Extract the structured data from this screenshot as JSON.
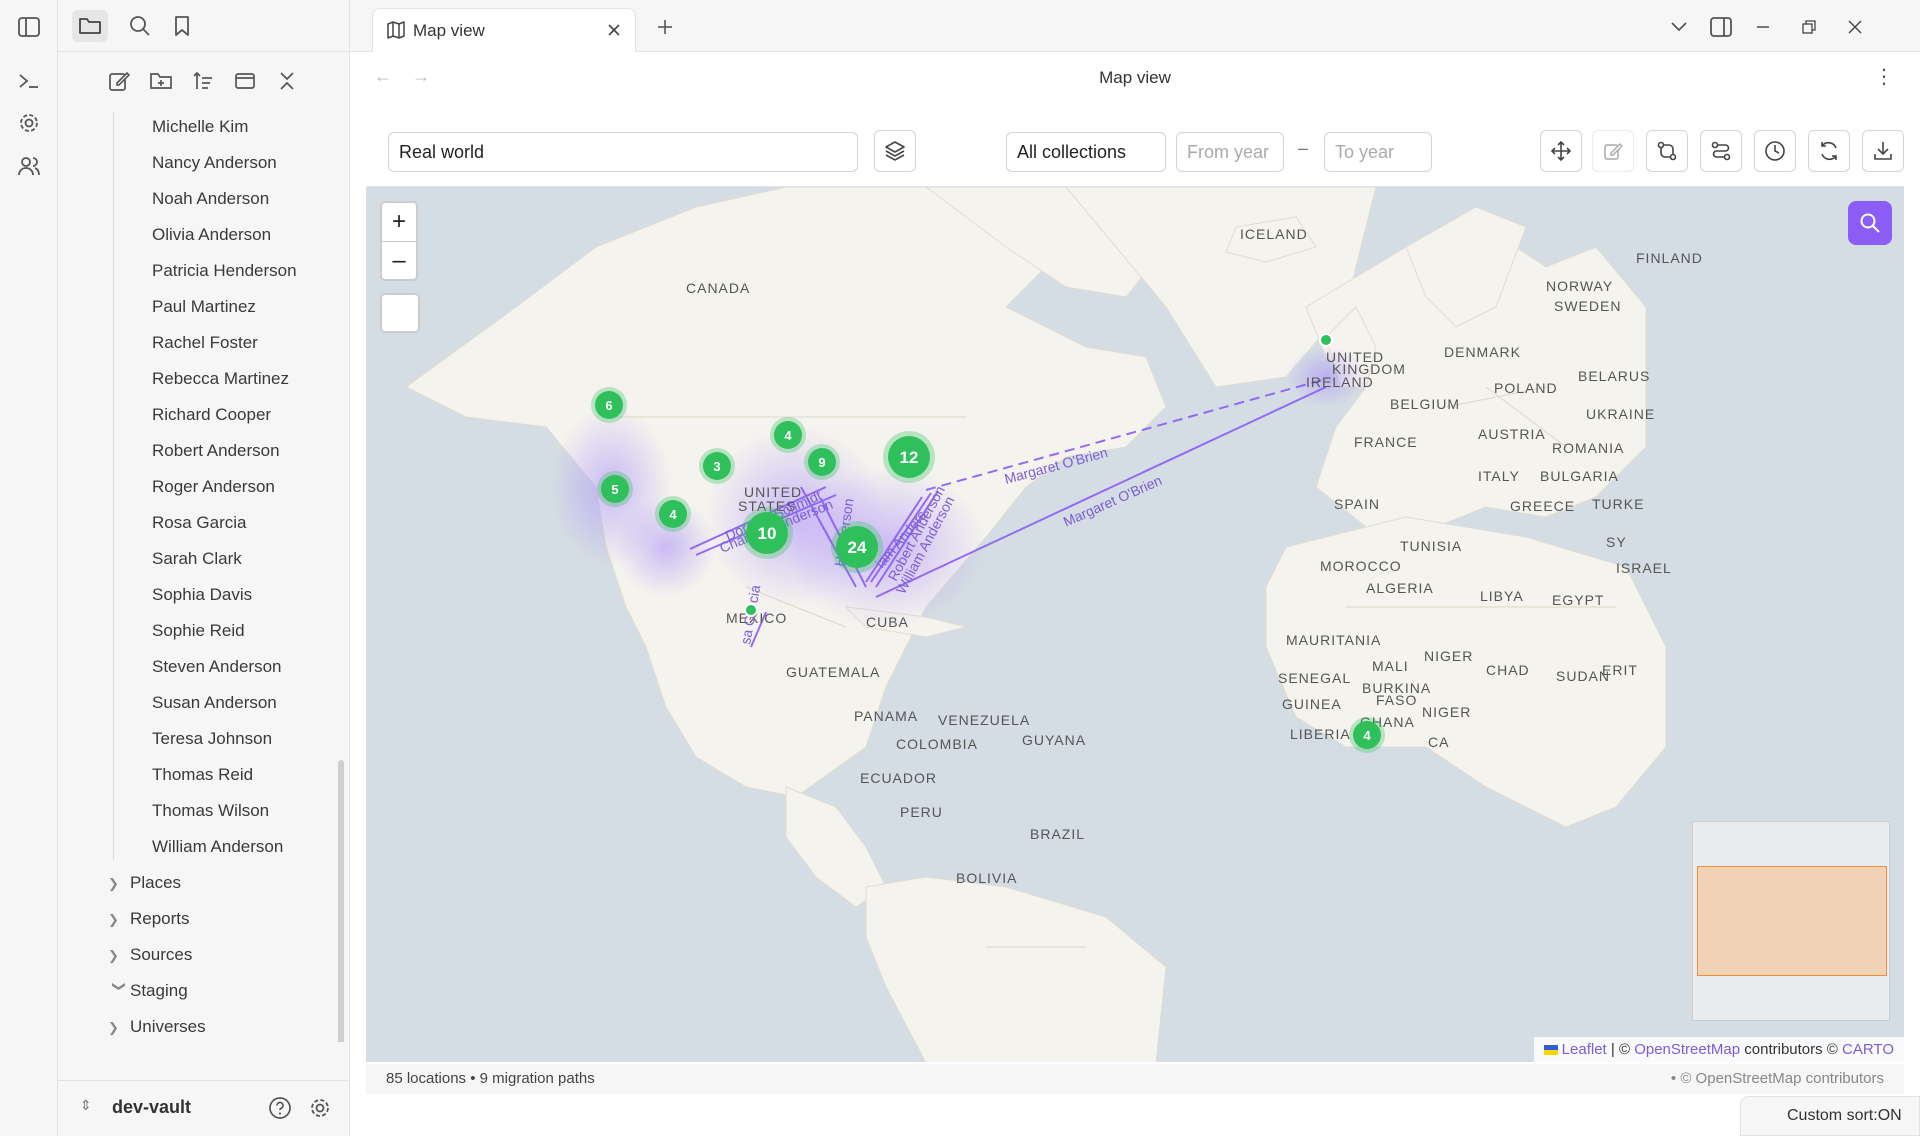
{
  "tab": {
    "title": "Map view"
  },
  "view": {
    "title": "Map view"
  },
  "people": [
    "Michelle Kim",
    "Nancy Anderson",
    "Noah Anderson",
    "Olivia Anderson",
    "Patricia Henderson",
    "Paul Martinez",
    "Rachel Foster",
    "Rebecca Martinez",
    "Richard Cooper",
    "Robert Anderson",
    "Roger Anderson",
    "Rosa Garcia",
    "Sarah Clark",
    "Sophia Davis",
    "Sophie Reid",
    "Steven Anderson",
    "Susan Anderson",
    "Teresa Johnson",
    "Thomas Reid",
    "Thomas Wilson",
    "William Anderson"
  ],
  "folders": [
    {
      "label": "Places",
      "expanded": false
    },
    {
      "label": "Reports",
      "expanded": false
    },
    {
      "label": "Sources",
      "expanded": false
    },
    {
      "label": "Staging",
      "expanded": true
    },
    {
      "label": "Universes",
      "expanded": false
    }
  ],
  "vault": {
    "name": "dev-vault"
  },
  "toolbar": {
    "map_select": "Real world",
    "collection_select": "All collections",
    "from_year_placeholder": "From year",
    "to_year_placeholder": "To year",
    "range_dash": "–"
  },
  "map": {
    "countries": [
      "ICELAND",
      "FINLAND",
      "NORWAY",
      "SWEDEN",
      "CANADA",
      "DENMARK",
      "UNITED",
      "KINGDOM",
      "IRELAND",
      "POLAND",
      "BELARUS",
      "BELGIUM",
      "UKRAINE",
      "FRANCE",
      "AUSTRIA",
      "ROMANIA",
      "ITALY",
      "BULGARIA",
      "UNITED",
      "STATES",
      "SPAIN",
      "GREECE",
      "TURKE",
      "TUNISIA",
      "MOROCCO",
      "ALGERIA",
      "LIBYA",
      "EGYPT",
      "ISRAEL",
      "MEXICO",
      "CUBA",
      "MAURITANIA",
      "MALI",
      "NIGER",
      "CHAD",
      "SUDAN",
      "SENEGAL",
      "BURKINA",
      "FASO",
      "GUINEA",
      "GHANA",
      "NIGER",
      "LIBERIA",
      "GUATEMALA",
      "PANAMA",
      "VENEZUELA",
      "GUYANA",
      "COLOMBIA",
      "ECUADOR",
      "PERU",
      "BRAZIL",
      "BOLIVIA",
      "SY",
      "ERIT",
      "CA"
    ],
    "clusters": [
      {
        "count": "6"
      },
      {
        "count": "5"
      },
      {
        "count": "4"
      },
      {
        "count": "3"
      },
      {
        "count": "4"
      },
      {
        "count": "9"
      },
      {
        "count": "12"
      },
      {
        "count": "10"
      },
      {
        "count": "24"
      },
      {
        "count": "4"
      }
    ],
    "path_labels": [
      "Margaret O'Brien",
      "Margaret O'Brien",
      "Dorothy Schmidt",
      "Charles Henderson",
      "Henderson",
      "iam Anders",
      "Robert Anderson",
      "William Anderson",
      "sa Garcia"
    ],
    "zoom_in": "+",
    "zoom_out": "–",
    "attribution": {
      "leaflet": "Leaflet",
      "sep": "| ©",
      "osm": "OpenStreetMap",
      "contrib": "contributors ©",
      "carto": "CARTO"
    },
    "accent": "#8b5cf6",
    "cluster_color": "#2fbf5b"
  },
  "status": {
    "summary": "85 locations • 9 migration paths",
    "credit": "• © OpenStreetMap contributors"
  },
  "sort_badge": "Custom sort:ON"
}
